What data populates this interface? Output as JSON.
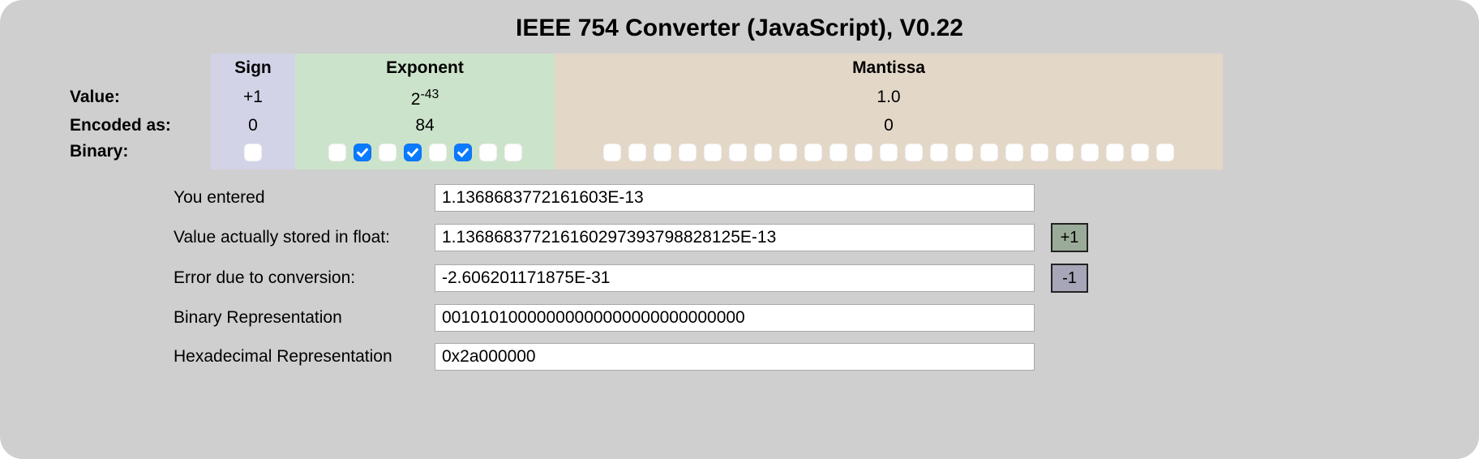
{
  "title": "IEEE 754 Converter (JavaScript), V0.22",
  "headers": {
    "sign": "Sign",
    "exponent": "Exponent",
    "mantissa": "Mantissa"
  },
  "row_labels": {
    "value": "Value:",
    "encoded": "Encoded as:",
    "binary": "Binary:"
  },
  "value_row": {
    "sign": "+1",
    "exponent_base": "2",
    "exponent_pow": "-43",
    "mantissa": "1.0"
  },
  "encoded_row": {
    "sign": "0",
    "exponent": "84",
    "mantissa": "0"
  },
  "binary": {
    "sign": [
      0
    ],
    "exponent": [
      0,
      1,
      0,
      1,
      0,
      1,
      0,
      0
    ],
    "mantissa": [
      0,
      0,
      0,
      0,
      0,
      0,
      0,
      0,
      0,
      0,
      0,
      0,
      0,
      0,
      0,
      0,
      0,
      0,
      0,
      0,
      0,
      0,
      0
    ]
  },
  "fields": {
    "entered": {
      "label": "You entered",
      "value": "1.1368683772161603E-13"
    },
    "stored": {
      "label": "Value actually stored in float:",
      "value": "1.13686837721616029739379882812​5E-13"
    },
    "error": {
      "label": "Error due to conversion:",
      "value": "-2.606201171875E-31"
    },
    "binrep": {
      "label": "Binary Representation",
      "value": "00101010000000000000000000000000​"
    },
    "hexrep": {
      "label": "Hexadecimal Representation",
      "value": "0x2a000000"
    }
  },
  "buttons": {
    "plus": "+1",
    "minus": "-1"
  }
}
